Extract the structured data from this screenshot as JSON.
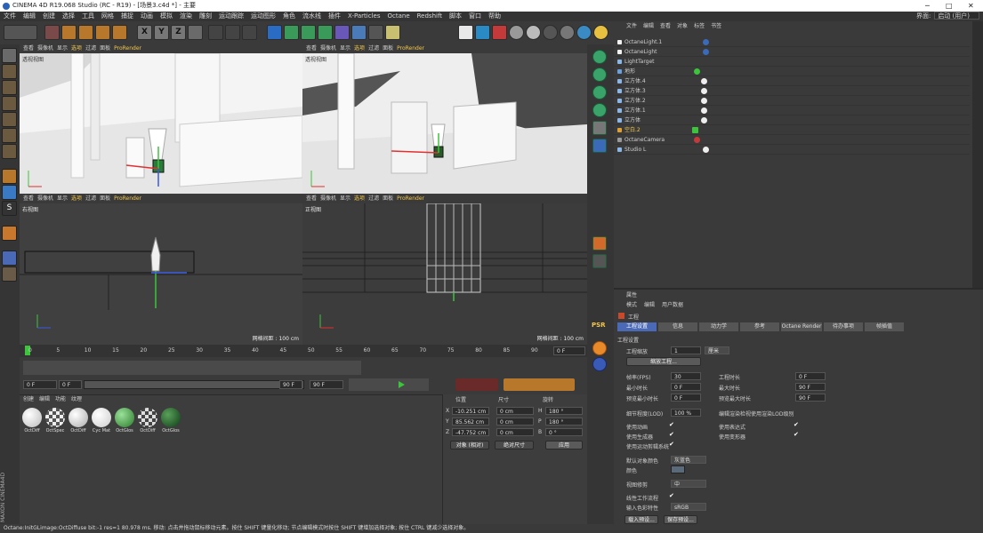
{
  "window": {
    "title": "CINEMA 4D R19.068 Studio (RC - R19) - [场景3.c4d *] - 主要",
    "min": "─",
    "max": "□",
    "close": "✕"
  },
  "menu": [
    "文件",
    "编辑",
    "创建",
    "选择",
    "工具",
    "网格",
    "捕捉",
    "动画",
    "模拟",
    "渲染",
    "雕刻",
    "运动跟踪",
    "运动图形",
    "角色",
    "流水线",
    "插件",
    "X-Particles",
    "Octane",
    "Redshift",
    "脚本",
    "窗口",
    "帮助"
  ],
  "interface": {
    "label": "界面:",
    "value": "启动 (用户)"
  },
  "toolbar": {
    "x": "X",
    "y": "Y",
    "z": "Z"
  },
  "viewport_menu": [
    "查看",
    "摄像机",
    "显示",
    "选项",
    "过滤",
    "面板"
  ],
  "viewport_renderer": "ProRender",
  "viewports": {
    "persp": {
      "label": "透视视图"
    },
    "camera": {
      "label": "透视视图"
    },
    "right": {
      "label": "右视图",
      "status": "网格间距 : 100 cm"
    },
    "front": {
      "label": "正视图",
      "status": "网格间距 : 100 cm"
    }
  },
  "timeline_ticks": [
    "0",
    "5",
    "10",
    "15",
    "20",
    "25",
    "30",
    "35",
    "40",
    "45",
    "50",
    "55",
    "60",
    "65",
    "70",
    "75",
    "80",
    "85",
    "90"
  ],
  "timeline_end": "0 F",
  "anim": {
    "start": "0 F",
    "current": "0 F",
    "range_end": "90 F",
    "end": "90 F"
  },
  "material": {
    "menu": [
      "创建",
      "编辑",
      "功能",
      "纹理"
    ],
    "items": [
      {
        "name": "OctDiff",
        "color": "#e8e8e8"
      },
      {
        "name": "OctSpec",
        "color": "checker"
      },
      {
        "name": "OctDiff",
        "color": "#dcdcdc"
      },
      {
        "name": "Cyc Mat",
        "color": "#f4f4f4"
      },
      {
        "name": "OctGlos",
        "color": "#4a9e4a"
      },
      {
        "name": "OctDiff",
        "color": "checker"
      },
      {
        "name": "OctGlos",
        "color": "#1f5a2a"
      }
    ]
  },
  "coords": {
    "headers": [
      "位置",
      "尺寸",
      "旋转"
    ],
    "rows": [
      {
        "axis": "X",
        "pos": "-10.251 cm",
        "size": "0 cm",
        "raxis": "H",
        "rot": "180 °"
      },
      {
        "axis": "Y",
        "pos": "85.562 cm",
        "size": "0 cm",
        "raxis": "P",
        "rot": "180 °"
      },
      {
        "axis": "Z",
        "pos": "-47.752 cm",
        "size": "0 cm",
        "raxis": "B",
        "rot": "0 °"
      }
    ],
    "mode1": "对象 (相对)",
    "mode2": "绝对尺寸",
    "apply": "应用"
  },
  "object_manager": {
    "menu": [
      "文件",
      "编辑",
      "查看",
      "对象",
      "标签",
      "书签"
    ],
    "objects": [
      {
        "name": "OctaneLight.1",
        "icon": "light-icon"
      },
      {
        "name": "OctaneLight",
        "icon": "light-icon"
      },
      {
        "name": "LightTarget",
        "icon": "null-icon"
      },
      {
        "name": "地形",
        "icon": "landscape-icon"
      },
      {
        "name": "立方体.4",
        "icon": "cube-icon"
      },
      {
        "name": "立方体.3",
        "icon": "cube-icon"
      },
      {
        "name": "立方体.2",
        "icon": "cube-icon"
      },
      {
        "name": "立方体.1",
        "icon": "cube-icon"
      },
      {
        "name": "立方体",
        "icon": "cube-icon"
      },
      {
        "name": "空白.2",
        "icon": "null-icon"
      },
      {
        "name": "OctaneCamera",
        "icon": "camera-icon"
      },
      {
        "name": "Studio L",
        "icon": "studio-icon"
      }
    ]
  },
  "attributes": {
    "title": "属性",
    "menu": [
      "模式",
      "编辑",
      "用户数据"
    ],
    "object": "工程",
    "tabs": [
      "工程设置",
      "信息",
      "动力学",
      "参考",
      "Octane Render",
      "待办事项",
      "帧插值"
    ],
    "section": "工程设置",
    "scale_label": "工程缩放",
    "scale_value": "1",
    "scale_unit": "厘米",
    "scale_button": "缩放工程...",
    "fps_label": "帧率(FPS)",
    "fps": "30",
    "project_time_label": "工程时长",
    "project_time": "0 F",
    "min_time_label": "最小时长",
    "min_time": "0 F",
    "max_time_label": "最大时长",
    "max_time": "90 F",
    "preview_min_label": "预览最小时长",
    "preview_min": "0 F",
    "preview_max_label": "预览最大时长",
    "preview_max": "90 F",
    "lod_label": "细节程度(LOD)",
    "lod": "100 %",
    "lod_render_label": "编辑渲染检视使用渲染LOD级别",
    "use_anim": "使用动画",
    "use_expr": "使用表达式",
    "use_gen": "使用生成器",
    "use_deform": "使用变形器",
    "use_motion": "使用运动剪辑系统",
    "default_color_label": "默认对象颜色",
    "default_color": "灰蓝色",
    "color_label": "颜色",
    "view_clip_label": "视图修剪",
    "view_clip": "中",
    "linear_label": "线性工作流程",
    "input_color_label": "输入色彩特性",
    "input_color": "sRGB",
    "load_preset": "载入预设...",
    "save_preset": "保存预设..."
  },
  "status": "Octane:InitGLimage:OctDiffuse  bit:-1 res=1  80.978 ms.   移动: 点击并拖动鼠标移动元素。按住 SHIFT 键量化移动; 节点编辑模式时按住 SHIFT 键增加选择对象; 按住 CTRL 键减少选择对象。",
  "brand": "MAXON CINEMA4D",
  "psr": "PSR"
}
